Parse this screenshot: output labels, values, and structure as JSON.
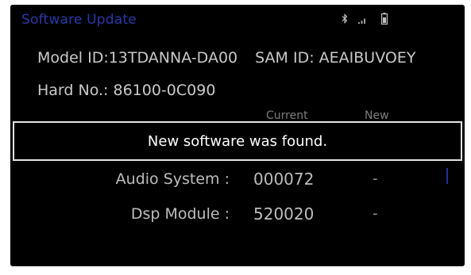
{
  "header": {
    "title": "Software Update",
    "icons": [
      "bluetooth-icon",
      "signal-icon",
      "battery-icon"
    ]
  },
  "info": {
    "model_id": "Model ID:13TDANNA-DA00",
    "sam_id": "SAM ID: AEAIBUVOEY",
    "hard_no": "Hard No.: 86100-0C090"
  },
  "columns": {
    "current": "Current",
    "new": "New"
  },
  "banner": {
    "message": "New software was found."
  },
  "rows": [
    {
      "label": "Audio System :",
      "current": "000072",
      "new": "-"
    },
    {
      "label": "Dsp Module :",
      "current": "520020",
      "new": "-"
    }
  ],
  "colors": {
    "screen_bg": "#000000",
    "title": "#2b39a8",
    "text": "#c9c9c9",
    "banner_border": "#e4e4e4",
    "accent": "#26309a"
  }
}
